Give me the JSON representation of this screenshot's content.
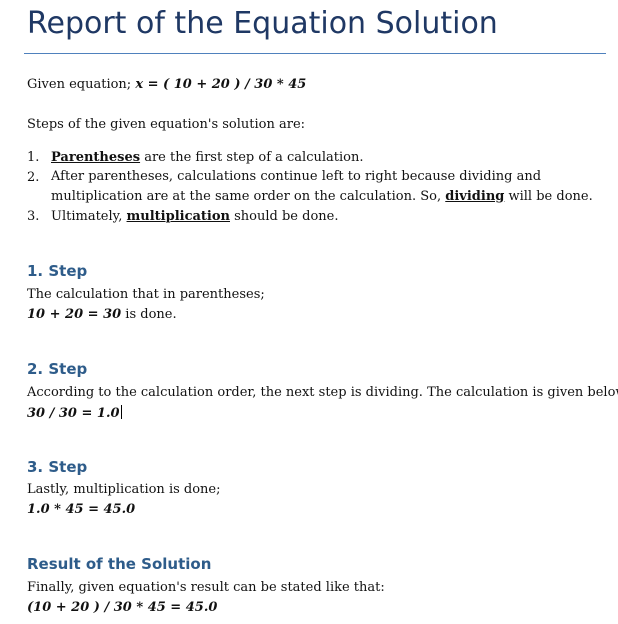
{
  "document": {
    "title": "Report of the Equation Solution",
    "given_prefix": "Given equation; ",
    "given_equation": "x = ( 10 + 20 ) / 30 * 45",
    "steps_intro": "Steps of the given equation's solution are:",
    "list": [
      {
        "number": "1.",
        "keyword": "Parentheses",
        "after": " are the first step of a calculation."
      },
      {
        "number": "2.",
        "before": "After parentheses, calculations continue left to right because dividing and multiplication are at the same order on the calculation. So, ",
        "keyword": "dividing",
        "after": " will be done."
      },
      {
        "number": "3.",
        "before": "Ultimately, ",
        "keyword": "multiplication",
        "after": " should be done."
      }
    ],
    "sections": [
      {
        "heading": "1. Step",
        "text": "The calculation that in parentheses;",
        "equation": "10 + 20 = 30",
        "equation_suffix": " is done."
      },
      {
        "heading": "2. Step",
        "text": "According to the calculation order, the next step is dividing. The calculation is given below.",
        "equation": "30 / 30 = 1.0"
      },
      {
        "heading": "3. Step",
        "text": "Lastly, multiplication is done;",
        "equation": "1.0 * 45 = 45.0"
      },
      {
        "heading": "Result of the Solution",
        "text": "Finally, given equation's result can be stated like that:",
        "equation": "(10 + 20 ) / 30 * 45 = 45.0"
      }
    ]
  }
}
